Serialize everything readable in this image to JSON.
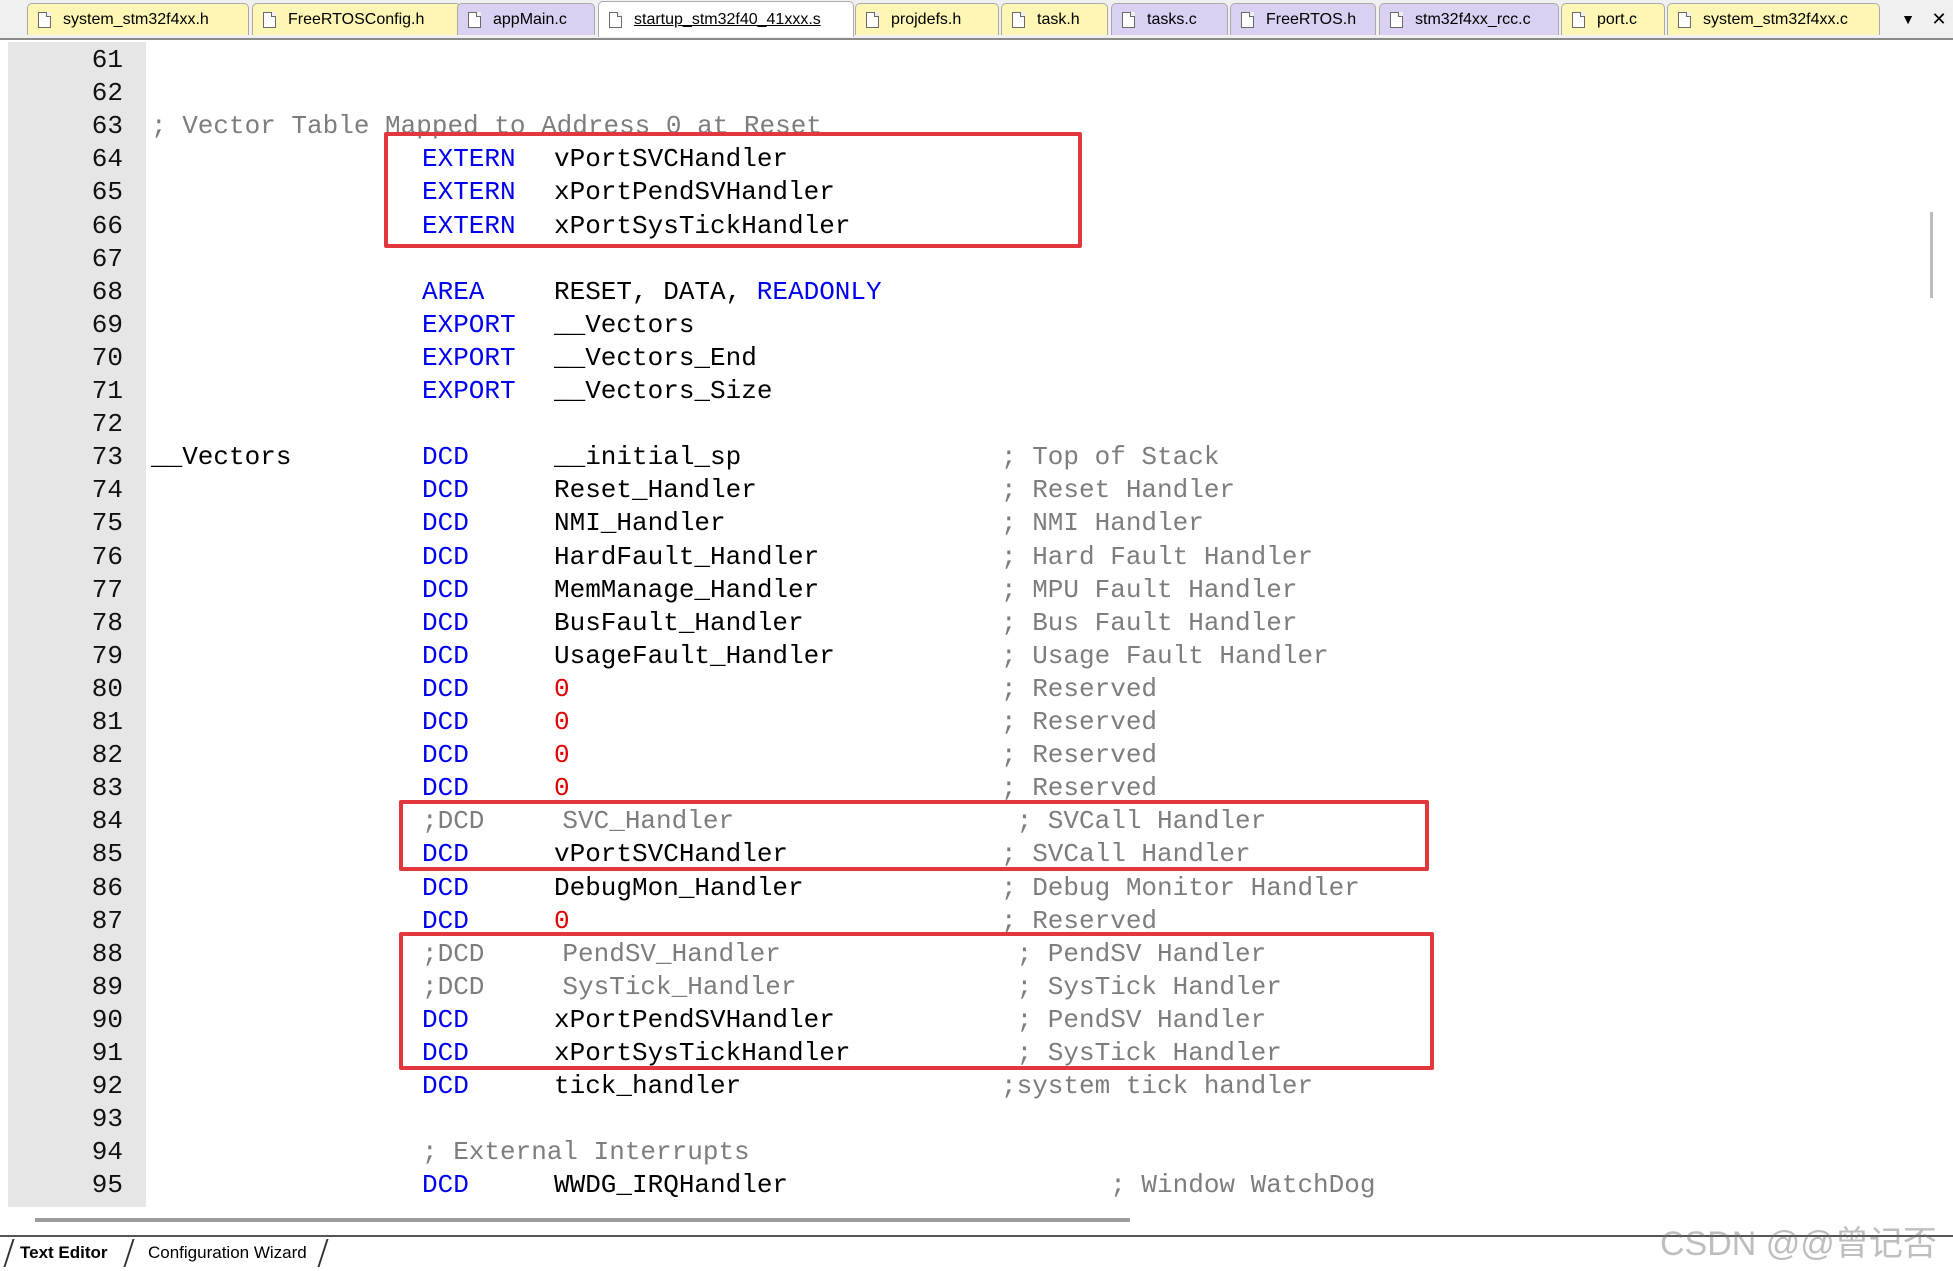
{
  "tabs": [
    {
      "label": "system_stm32f4xx.h",
      "kind": "header"
    },
    {
      "label": "FreeRTOSConfig.h",
      "kind": "header"
    },
    {
      "label": "appMain.c",
      "kind": "source"
    },
    {
      "label": "startup_stm32f40_41xxx.s",
      "kind": "active"
    },
    {
      "label": "projdefs.h",
      "kind": "header"
    },
    {
      "label": "task.h",
      "kind": "header"
    },
    {
      "label": "tasks.c",
      "kind": "source"
    },
    {
      "label": "FreeRTOS.h",
      "kind": "source"
    },
    {
      "label": "stm32f4xx_rcc.c",
      "kind": "source"
    },
    {
      "label": "port.c",
      "kind": "header"
    },
    {
      "label": "system_stm32f4xx.c",
      "kind": "header"
    }
  ],
  "tab_dropdown_glyph": "▼",
  "tab_close_glyph": "✕",
  "editor": {
    "lines": [
      {
        "n": "61",
        "label": "",
        "op": "",
        "arg": "",
        "comment": ""
      },
      {
        "n": "62",
        "label": "",
        "op": "",
        "arg": "",
        "comment": ""
      },
      {
        "n": "63",
        "label": "; Vector Table Mapped to Address 0 at Reset",
        "op": "",
        "arg": "",
        "comment": "",
        "label_is_comment": true
      },
      {
        "n": "64",
        "label": "",
        "op": "EXTERN",
        "arg": "vPortSVCHandler",
        "comment": ""
      },
      {
        "n": "65",
        "label": "",
        "op": "EXTERN",
        "arg": "xPortPendSVHandler",
        "comment": ""
      },
      {
        "n": "66",
        "label": "",
        "op": "EXTERN",
        "arg": "xPortSysTickHandler",
        "comment": ""
      },
      {
        "n": "67",
        "label": "",
        "op": "",
        "arg": "",
        "comment": ""
      },
      {
        "n": "68",
        "label": "",
        "op": "AREA",
        "arg": "RESET, DATA, ",
        "arg_kw": "READONLY",
        "comment": ""
      },
      {
        "n": "69",
        "label": "",
        "op": "EXPORT",
        "arg": "__Vectors",
        "comment": ""
      },
      {
        "n": "70",
        "label": "",
        "op": "EXPORT",
        "arg": "__Vectors_End",
        "comment": ""
      },
      {
        "n": "71",
        "label": "",
        "op": "EXPORT",
        "arg": "__Vectors_Size",
        "comment": ""
      },
      {
        "n": "72",
        "label": "",
        "op": "",
        "arg": "",
        "comment": ""
      },
      {
        "n": "73",
        "label": "__Vectors",
        "op": "DCD",
        "arg": "__initial_sp",
        "comment": "; Top of Stack"
      },
      {
        "n": "74",
        "label": "",
        "op": "DCD",
        "arg": "Reset_Handler",
        "comment": "; Reset Handler"
      },
      {
        "n": "75",
        "label": "",
        "op": "DCD",
        "arg": "NMI_Handler",
        "comment": "; NMI Handler"
      },
      {
        "n": "76",
        "label": "",
        "op": "DCD",
        "arg": "HardFault_Handler",
        "comment": "; Hard Fault Handler"
      },
      {
        "n": "77",
        "label": "",
        "op": "DCD",
        "arg": "MemManage_Handler",
        "comment": "; MPU Fault Handler"
      },
      {
        "n": "78",
        "label": "",
        "op": "DCD",
        "arg": "BusFault_Handler",
        "comment": "; Bus Fault Handler"
      },
      {
        "n": "79",
        "label": "",
        "op": "DCD",
        "arg": "UsageFault_Handler",
        "comment": "; Usage Fault Handler"
      },
      {
        "n": "80",
        "label": "",
        "op": "DCD",
        "arg": "0",
        "arg_num": true,
        "comment": "; Reserved"
      },
      {
        "n": "81",
        "label": "",
        "op": "DCD",
        "arg": "0",
        "arg_num": true,
        "comment": "; Reserved"
      },
      {
        "n": "82",
        "label": "",
        "op": "DCD",
        "arg": "0",
        "arg_num": true,
        "comment": "; Reserved"
      },
      {
        "n": "83",
        "label": "",
        "op": "DCD",
        "arg": "0",
        "arg_num": true,
        "comment": "; Reserved"
      },
      {
        "n": "84",
        "label": "",
        "full_comment": ";DCD     SVC_Handler",
        "op": "",
        "arg": "",
        "comment": " ; SVCall Handler"
      },
      {
        "n": "85",
        "label": "",
        "op": "DCD",
        "arg": "vPortSVCHandler",
        "comment": "; SVCall Handler"
      },
      {
        "n": "86",
        "label": "",
        "op": "DCD",
        "arg": "DebugMon_Handler",
        "comment": "; Debug Monitor Handler"
      },
      {
        "n": "87",
        "label": "",
        "op": "DCD",
        "arg": "0",
        "arg_num": true,
        "comment": "; Reserved"
      },
      {
        "n": "88",
        "label": "",
        "full_comment": ";DCD     PendSV_Handler",
        "op": "",
        "arg": "",
        "comment": " ; PendSV Handler"
      },
      {
        "n": "89",
        "label": "",
        "full_comment": ";DCD     SysTick_Handler",
        "op": "",
        "arg": "",
        "comment": " ; SysTick Handler"
      },
      {
        "n": "90",
        "label": "",
        "op": "DCD",
        "arg": "xPortPendSVHandler",
        "comment": " ; PendSV Handler"
      },
      {
        "n": "91",
        "label": "",
        "op": "DCD",
        "arg": "xPortSysTickHandler",
        "comment": " ; SysTick Handler"
      },
      {
        "n": "92",
        "label": "",
        "op": "DCD",
        "arg": "tick_handler",
        "comment": ";system tick handler"
      },
      {
        "n": "93",
        "label": "",
        "op": "",
        "arg": "",
        "comment": ""
      },
      {
        "n": "94",
        "label": "",
        "full_comment": "; External Interrupts",
        "op": "",
        "arg": "",
        "comment": ""
      },
      {
        "n": "95",
        "label": "",
        "op": "DCD",
        "arg": "WWDG_IRQHandler",
        "comment": "       ; Window WatchDog"
      }
    ]
  },
  "bottom_tabs": [
    {
      "label": "Text Editor",
      "active": true
    },
    {
      "label": "Configuration Wizard",
      "active": false
    }
  ],
  "watermark": "CSDN @@曾记否"
}
